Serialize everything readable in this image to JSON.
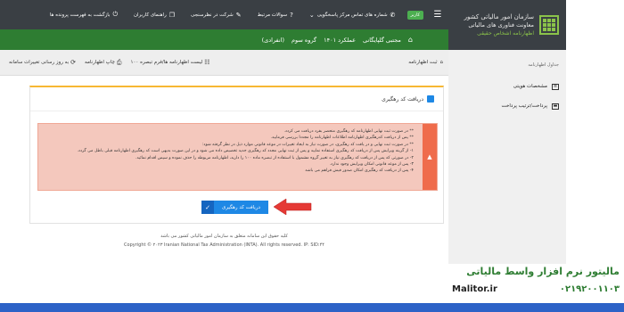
{
  "topbar": {
    "badge": "کاربر",
    "phone": "شماره های تماس مرکز پاسخگویی",
    "faq": "سوالات مرتبط",
    "survey": "شرکت در نظرسنجی",
    "guide": "راهنمای کاربران",
    "back": "بازگشت به فهرست پرونده ها"
  },
  "brand": {
    "line1": "سازمان امور مالیاتی کشور",
    "line2": "معاونت فناوری های مالیاتی",
    "line3": "اظهارنامه اشخاص حقیقی"
  },
  "header": {
    "taxpayer": "مجتبی گلپایگانی",
    "period": "عملکرد ۱۴۰۱",
    "group": "گروه سوم",
    "type": "(انفرادی)"
  },
  "toolbar": {
    "home": "ثبت اظهارنامه",
    "list": "لیست اظهارنامه ها/فرم تبصره ۱۰۰",
    "print": "چاپ اظهارنامه",
    "update": "به روز رسانی تغییرات سامانه"
  },
  "sidebar": {
    "caption": "جداول اظهارنامه",
    "items": [
      {
        "label": "مشخصات هویتی"
      },
      {
        "label": "پرداخت/ترتیب پرداخت"
      }
    ]
  },
  "card": {
    "title": "دریافت کد رهگیری",
    "alert_lines": [
      "** در صورت ثبت نهایی اظهارنامه کد رهگیری منحصر بفرد دریافت می کردد.",
      "** پس از دریافت کدرهگیری اظهارنامه اطلاعات اظهارنامه را مجددا بررسی فرمایید.",
      "** در صورت ثبت نهایی و در یافت کد رهگیری، در صورت نیاز به ایجاد تغییرات در موعد قانونی موارد ذیل در نظر گرفته شود:",
      "۱- از گزینه ویرایش پس از دریافت کد رهگیری استفاده نمایید و پس از ثبت نهایی مجدد کد رهگیری جدید تخصیص داده می شود و در این صورت بدیهی است کد رهگیری اظهارنامه قبلی باطل می گردد.",
      "۲- در صورتی که پس از دریافت کد رهگیری نیاز به تغییر گروه مشمول با استفاده از تبصره ماده ۱۰۰ را دارید، اظهارنامه مربوطه را حذف نموده و سپس اقدام نمائید.",
      "۳- پس از موعد قانونی امکان ویرایش وجود ندارد.",
      "۴- پس از دریافت کد رهگیری امکان صدور فیش فراهم می باشد"
    ],
    "button": "دریافت کد رهگیری"
  },
  "footer": {
    "rights": "کلیه حقوق این سامانه متعلق به سازمان امور مالیاتی کشور می باشد",
    "copyright": "Copyright © ۲۰۲۳ Iranian National Tax Administration (INTA). All rights reserved. IP: SID:۴۴"
  },
  "watermark": {
    "title": "مالیتور نرم افزار واسط مالیاتی",
    "site": "Malitor.ir",
    "phone": "۰۲۱۹۲۰۰۱۱۰۳"
  },
  "colors": {
    "accent_green": "#2e7d32",
    "alert_bg": "#f4c8bd",
    "button_blue": "#1e88e5",
    "arrow_red": "#e53935"
  }
}
